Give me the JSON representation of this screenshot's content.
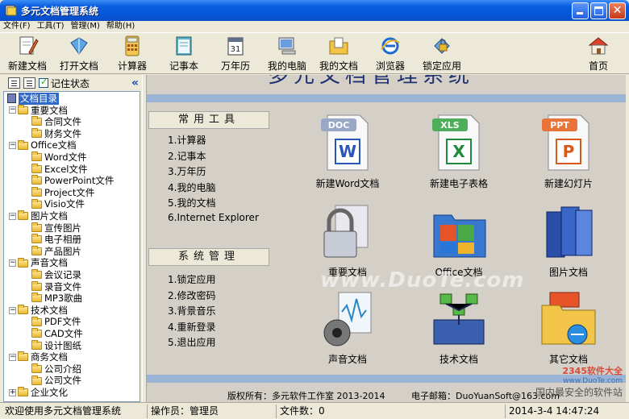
{
  "window": {
    "title": "多元文档管理系统",
    "close_glyph": "✕"
  },
  "menu": [
    {
      "label": "文件(F)"
    },
    {
      "label": "工具(T)"
    },
    {
      "label": "管理(M)"
    },
    {
      "label": "帮助(H)"
    }
  ],
  "toolbar": [
    {
      "label": "新建文档",
      "icon": "new-document-icon"
    },
    {
      "label": "打开文档",
      "icon": "open-document-icon"
    },
    {
      "label": "计算器",
      "icon": "calculator-icon"
    },
    {
      "label": "记事本",
      "icon": "notepad-icon"
    },
    {
      "label": "万年历",
      "icon": "calendar-icon"
    },
    {
      "label": "我的电脑",
      "icon": "my-computer-icon"
    },
    {
      "label": "我的文档",
      "icon": "my-documents-icon"
    },
    {
      "label": "浏览器",
      "icon": "browser-icon"
    },
    {
      "label": "锁定应用",
      "icon": "lock-app-icon"
    },
    {
      "label": "首页",
      "icon": "home-icon"
    }
  ],
  "sidebar": {
    "remember_label": "记住状态",
    "remember_checked": true,
    "collapse_glyph": "«",
    "tree": [
      {
        "label": "文档目录",
        "level": 0,
        "root": true
      },
      {
        "label": "重要文档",
        "level": 1,
        "expander": "−"
      },
      {
        "label": "合同文件",
        "level": 2
      },
      {
        "label": "财务文件",
        "level": 2
      },
      {
        "label": "Office文档",
        "level": 1,
        "expander": "−"
      },
      {
        "label": "Word文件",
        "level": 2
      },
      {
        "label": "Excel文件",
        "level": 2
      },
      {
        "label": "PowerPoint文件",
        "level": 2
      },
      {
        "label": "Project文件",
        "level": 2
      },
      {
        "label": "Visio文件",
        "level": 2
      },
      {
        "label": "图片文档",
        "level": 1,
        "expander": "−"
      },
      {
        "label": "宣传图片",
        "level": 2
      },
      {
        "label": "电子相册",
        "level": 2
      },
      {
        "label": "产品图片",
        "level": 2
      },
      {
        "label": "声音文档",
        "level": 1,
        "expander": "−"
      },
      {
        "label": "会议记录",
        "level": 2
      },
      {
        "label": "录音文件",
        "level": 2
      },
      {
        "label": "MP3歌曲",
        "level": 2
      },
      {
        "label": "技术文档",
        "level": 1,
        "expander": "−"
      },
      {
        "label": "PDF文件",
        "level": 2
      },
      {
        "label": "CAD文件",
        "level": 2
      },
      {
        "label": "设计图纸",
        "level": 2
      },
      {
        "label": "商务文档",
        "level": 1,
        "expander": "−"
      },
      {
        "label": "公司介绍",
        "level": 2
      },
      {
        "label": "公司文件",
        "level": 2
      },
      {
        "label": "企业文化",
        "level": 1,
        "expander": "+"
      }
    ]
  },
  "main": {
    "hero_title": "多元文档管理系统",
    "common_tools": {
      "heading": "常用工具",
      "items": [
        "1.计算器",
        "2.记事本",
        "3.万年历",
        "4.我的电脑",
        "5.我的文档",
        "6.Internet Explorer"
      ]
    },
    "system_mgmt": {
      "heading": "系统管理",
      "items": [
        "1.锁定应用",
        "2.修改密码",
        "3.背景音乐",
        "4.重新登录",
        "5.退出应用"
      ]
    },
    "grid": [
      {
        "label": "新建Word文档",
        "icon": "word-doc-icon",
        "badge": "DOC",
        "glyph": "W"
      },
      {
        "label": "新建电子表格",
        "icon": "excel-sheet-icon",
        "badge": "XLS",
        "glyph": "X"
      },
      {
        "label": "新建幻灯片",
        "icon": "powerpoint-slide-icon",
        "badge": "PPT",
        "glyph": "P"
      },
      {
        "label": "重要文档",
        "icon": "locked-document-icon"
      },
      {
        "label": "Office文档",
        "icon": "office-folder-icon"
      },
      {
        "label": "图片文档",
        "icon": "picture-books-icon"
      },
      {
        "label": "声音文档",
        "icon": "sound-document-icon"
      },
      {
        "label": "技术文档",
        "icon": "tech-network-icon"
      },
      {
        "label": "其它文档",
        "icon": "other-folder-icon"
      }
    ],
    "footer_copyright": "版权所有：多元软件工作室 2013-2014",
    "footer_email": "电子邮箱：DuoYuanSoft@163.com"
  },
  "watermark": {
    "center": "www.DuoTe.com",
    "corner_a": "2345软件大全",
    "corner_b": "www.DuoTe.com",
    "corner_c": "国内最安全的软件站"
  },
  "status": {
    "welcome": "欢迎使用多元文档管理系统",
    "operator": "操作员：管理员",
    "file_count": "文件数：0",
    "datetime": "2014-3-4 14:47:24"
  },
  "colors": {
    "titlebar": "#0456d8",
    "selection": "#316ac5",
    "band": "#9bb3d4"
  }
}
